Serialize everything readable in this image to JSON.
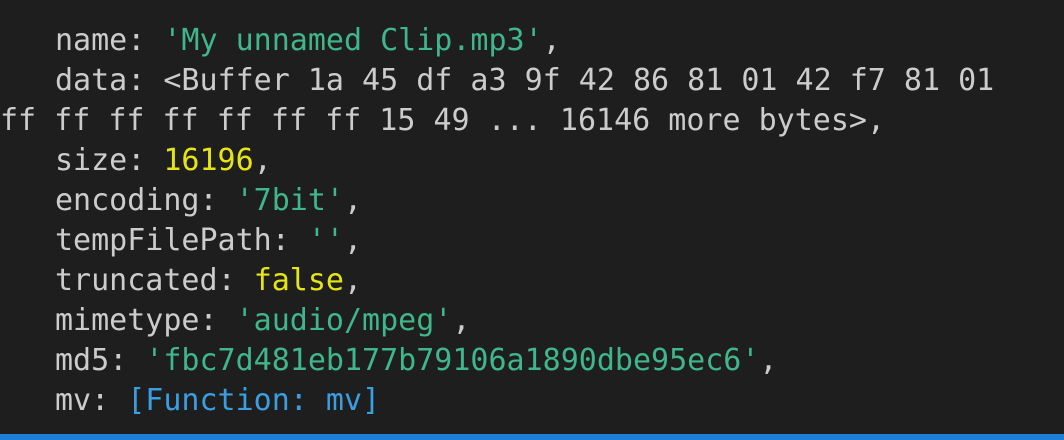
{
  "lines": {
    "name": {
      "key": "name",
      "value": "'My unnamed Clip.mp3'"
    },
    "data": {
      "key": "data",
      "value": "<Buffer 1a 45 df a3 9f 42 86 81 01 42 f7 81 01"
    },
    "data_cont": {
      "value": "ff ff ff ff ff ff ff 15 49 ... 16146 more bytes>"
    },
    "size": {
      "key": "size",
      "value": "16196"
    },
    "encoding": {
      "key": "encoding",
      "value": "'7bit'"
    },
    "tempFilePath": {
      "key": "tempFilePath",
      "value": "''"
    },
    "truncated": {
      "key": "truncated",
      "value": "false"
    },
    "mimetype": {
      "key": "mimetype",
      "value": "'audio/mpeg'"
    },
    "md5": {
      "key": "md5",
      "value": "'fbc7d481eb177b79106a1890dbe95ec6'"
    },
    "mv": {
      "key": "mv",
      "value": "[Function: mv]"
    }
  },
  "colors": {
    "background": "#1e1e1e",
    "text": "#cccccc",
    "string": "#3fb68b",
    "number_boolean": "#e5e510",
    "function": "#3b9ee0",
    "status_bar": "#1f7fd6"
  }
}
